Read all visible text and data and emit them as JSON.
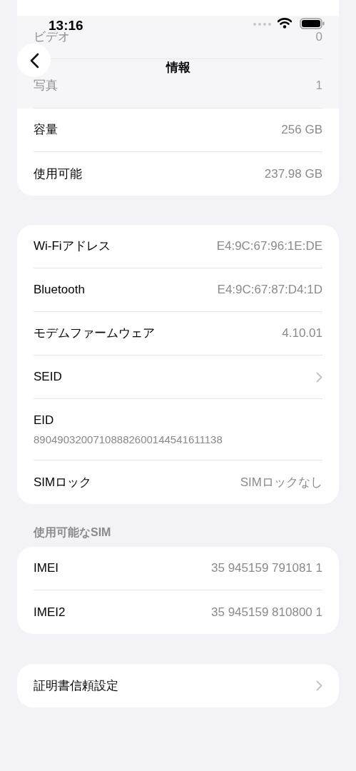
{
  "status_bar": {
    "time": "13:16"
  },
  "nav": {
    "title": "情報"
  },
  "sections": [
    {
      "rows": [
        {
          "kind": "value",
          "label": "ビデオ",
          "value": "0",
          "faded": true
        },
        {
          "kind": "value",
          "label": "写真",
          "value": "1",
          "faded": true
        },
        {
          "kind": "value",
          "label": "容量",
          "value": "256 GB",
          "faded": false
        },
        {
          "kind": "value",
          "label": "使用可能",
          "value": "237.98 GB",
          "faded": false
        }
      ]
    },
    {
      "rows": [
        {
          "kind": "value",
          "label": "Wi-Fiアドレス",
          "value": "E4:9C:67:96:1E:DE",
          "faded": false
        },
        {
          "kind": "value",
          "label": "Bluetooth",
          "value": "E4:9C:67:87:D4:1D",
          "faded": false
        },
        {
          "kind": "value",
          "label": "モデムファームウェア",
          "value": "4.10.01",
          "faded": false
        },
        {
          "kind": "chevron",
          "label": "SEID",
          "faded": false
        },
        {
          "kind": "stacked",
          "label": "EID",
          "value": "89049032007108882600144541611138",
          "faded": false
        },
        {
          "kind": "value",
          "label": "SIMロック",
          "value": "SIMロックなし",
          "faded": false
        }
      ]
    },
    {
      "header": "使用可能なSIM",
      "rows": [
        {
          "kind": "value",
          "label": "IMEI",
          "value": "35 945159 791081 1",
          "faded": false
        },
        {
          "kind": "value",
          "label": "IMEI2",
          "value": "35 945159 810800 1",
          "faded": false
        }
      ]
    },
    {
      "rows": [
        {
          "kind": "chevron",
          "label": "証明書信頼設定",
          "faded": false
        }
      ]
    }
  ]
}
